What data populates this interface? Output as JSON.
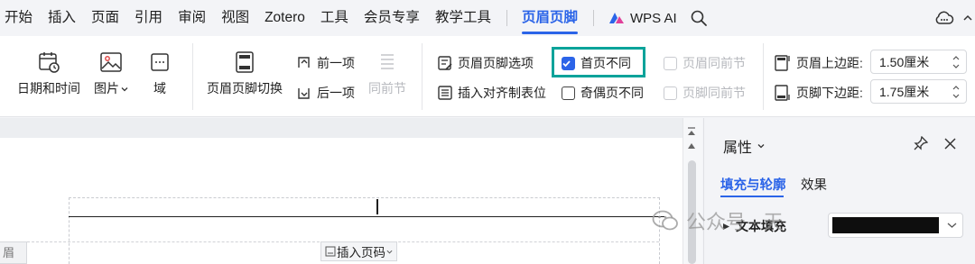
{
  "menu": {
    "items": [
      "开始",
      "插入",
      "页面",
      "引用",
      "审阅",
      "视图",
      "Zotero",
      "工具",
      "会员专享",
      "教学工具"
    ],
    "active": "页眉页脚",
    "ai": "WPS AI"
  },
  "ribbon": {
    "date_time": "日期和时间",
    "picture": "图片",
    "field": "域",
    "switch_header_footer": "页眉页脚切换",
    "prev_item": "前一项",
    "next_item": "后一项",
    "same_as_prev": "同前节",
    "header_footer_options": "页眉页脚选项",
    "insert_align_tab": "插入对齐制表位",
    "first_page_different": "首页不同",
    "first_page_different_checked": true,
    "odd_even_different": "奇偶页不同",
    "odd_even_different_checked": false,
    "header_same_as_prev": "页眉同前节",
    "footer_same_as_prev": "页脚同前节",
    "header_top_margin_label": "页眉上边距:",
    "header_top_margin_value": "1.50厘米",
    "footer_bottom_margin_label": "页脚下边距:",
    "footer_bottom_margin_value": "1.75厘米"
  },
  "document": {
    "header_label": "眉",
    "insert_page_number": "插入页码"
  },
  "panel": {
    "title": "属性",
    "tab_fill_outline": "填充与轮廓",
    "tab_effects": "效果",
    "text_fill_label": "文本填充"
  },
  "watermark": {
    "text": "公众号 · 天"
  },
  "colors": {
    "accent": "#2b64e8",
    "highlight_box": "#0aa39a"
  }
}
